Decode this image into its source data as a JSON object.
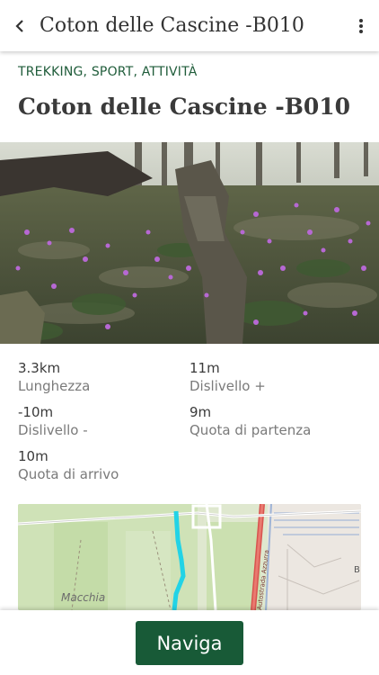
{
  "header": {
    "title": "Coton delle Cascine -B010",
    "back_icon": "back-arrow-icon",
    "menu_icon": "more-vertical-icon"
  },
  "category": "TREKKING, SPORT, ATTIVITÀ",
  "title": "Coton delle Cascine -B010",
  "stats": {
    "length": {
      "value": "3.3km",
      "label": "Lunghezza"
    },
    "elevation_gain": {
      "value": "11m",
      "label": "Dislivello +"
    },
    "elevation_loss": {
      "value": "-10m",
      "label": "Dislivello -"
    },
    "start_altitude": {
      "value": "9m",
      "label": "Quota di partenza"
    },
    "end_altitude": {
      "value": "10m",
      "label": "Quota di arrivo"
    }
  },
  "map": {
    "place_label": "Macchia",
    "road_label": "Autostrada Azzurra",
    "edge_letter": "B",
    "route_color": "#22d3e6"
  },
  "footer": {
    "navigate_label": "Naviga"
  },
  "colors": {
    "accent": "#185a37",
    "category": "#1f5c3a"
  }
}
